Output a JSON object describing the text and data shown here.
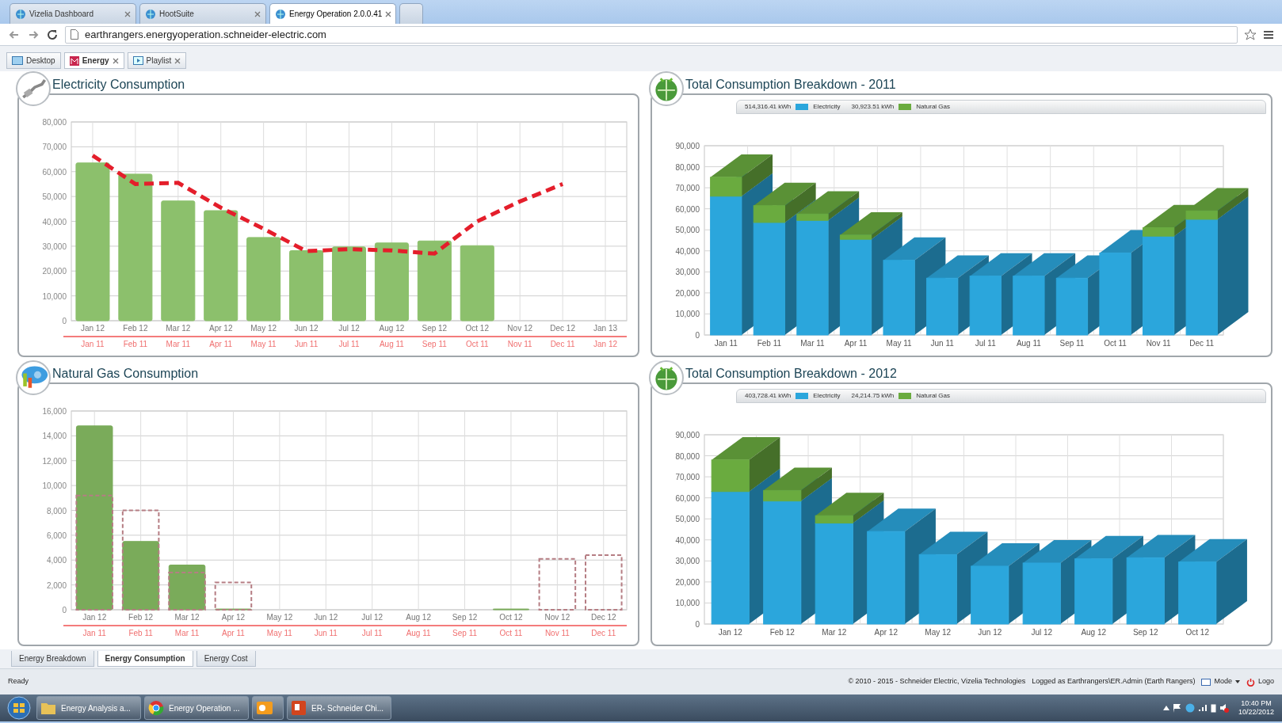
{
  "browser": {
    "tabs": [
      {
        "label": "Vizelia Dashboard",
        "selected": false,
        "closable": true
      },
      {
        "label": "HootSuite",
        "selected": false,
        "closable": true
      },
      {
        "label": "Energy Operation 2.0.0.41",
        "selected": true,
        "closable": true
      }
    ],
    "address": "earthrangers.energyoperation.schneider-electric.com"
  },
  "app_tabs": [
    {
      "label": "Desktop",
      "selected": false,
      "closable": false,
      "kind": "desktop"
    },
    {
      "label": "Energy",
      "selected": true,
      "closable": true,
      "kind": "energy"
    },
    {
      "label": "Playlist",
      "selected": false,
      "closable": true,
      "kind": "playlist"
    }
  ],
  "panels": [
    {
      "title": "Electricity Consumption",
      "kind": "plug",
      "secondary_axis": [
        "Jan 11",
        "Feb 11",
        "Mar 11",
        "Apr 11",
        "May 11",
        "Jun 11",
        "Jul 11",
        "Aug 11",
        "Sep 11",
        "Oct 11",
        "Nov 11",
        "Dec 11",
        "Jan 12"
      ],
      "chart_data": {
        "type": "bar",
        "grid": true,
        "categories": [
          "Jan 12",
          "Feb 12",
          "Mar 12",
          "Apr 12",
          "May 12",
          "Jun 12",
          "Jul 12",
          "Aug 12",
          "Sep 12",
          "Oct 12",
          "Nov 12",
          "Dec 12",
          "Jan 13"
        ],
        "ylim": [
          0,
          80000
        ],
        "yticks": [
          {
            "value": 0,
            "label": "0"
          },
          {
            "value": 10000,
            "label": "10,000"
          },
          {
            "value": 20000,
            "label": "20,000"
          },
          {
            "value": 30000,
            "label": "30,000"
          },
          {
            "value": 40000,
            "label": "40,000"
          },
          {
            "value": 50000,
            "label": "50,000"
          },
          {
            "value": 60000,
            "label": "60,000"
          },
          {
            "value": 70000,
            "label": "70,000"
          },
          {
            "value": 80000,
            "label": "80,000"
          }
        ],
        "series": [
          {
            "type": "bar",
            "color": "#8cc06c",
            "values": [
              63500,
              59000,
              48200,
              44300,
              33500,
              28200,
              29700,
              31300,
              32100,
              30200,
              null,
              null,
              null
            ]
          },
          {
            "type": "line",
            "line_style": "dashed",
            "color": "#e41e2b",
            "values": [
              66500,
              55000,
              55500,
              45500,
              37000,
              28000,
              28800,
              28300,
              27000,
              40000,
              48000,
              55000,
              null
            ]
          }
        ]
      }
    },
    {
      "title": "Total Consumption Breakdown - 2011",
      "kind": "earth",
      "totals": [
        "514,316.41 kWh",
        "30,923.51 kWh"
      ],
      "chart_data": {
        "type": "bar",
        "grid": true,
        "stacked": true,
        "categories": [
          "Jan 11",
          "Feb 11",
          "Mar 11",
          "Apr 11",
          "May 11",
          "Jun 11",
          "Jul 11",
          "Aug 11",
          "Sep 11",
          "Oct 11",
          "Nov 11",
          "Dec 11"
        ],
        "ylim": [
          0,
          90000
        ],
        "yticks": [
          {
            "value": 0,
            "label": "0"
          },
          {
            "value": 10000,
            "label": "10,000"
          },
          {
            "value": 20000,
            "label": "20,000"
          },
          {
            "value": 30000,
            "label": "30,000"
          },
          {
            "value": 40000,
            "label": "40,000"
          },
          {
            "value": 50000,
            "label": "50,000"
          },
          {
            "value": 60000,
            "label": "60,000"
          },
          {
            "value": 70000,
            "label": "70,000"
          },
          {
            "value": 80000,
            "label": "80,000"
          },
          {
            "value": 90000,
            "label": "90,000"
          }
        ],
        "series": [
          {
            "name": "Electricity",
            "color": "#2ba6dc",
            "values": [
              66000,
              53500,
              54500,
              45500,
              35500,
              27000,
              28000,
              28000,
              27000,
              39000,
              47000,
              55000
            ]
          },
          {
            "name": "Natural Gas",
            "color": "#6aab3f",
            "values": [
              9000,
              8000,
              3000,
              2000,
              0,
              0,
              0,
              0,
              0,
              0,
              4000,
              4000
            ]
          }
        ]
      }
    },
    {
      "title": "Natural Gas Consumption",
      "kind": "gas",
      "secondary_axis": [
        "Jan 11",
        "Feb 11",
        "Mar 11",
        "Apr 11",
        "May 11",
        "Jun 11",
        "Jul 11",
        "Aug 11",
        "Sep 11",
        "Oct 11",
        "Nov 11",
        "Dec 11"
      ],
      "chart_data": {
        "type": "bar",
        "grid": true,
        "categories": [
          "Jan 12",
          "Feb 12",
          "Mar 12",
          "Apr 12",
          "May 12",
          "Jun 12",
          "Jul 12",
          "Aug 12",
          "Sep 12",
          "Oct 12",
          "Nov 12",
          "Dec 12"
        ],
        "ylim": [
          0,
          16000
        ],
        "yticks": [
          {
            "value": 0,
            "label": "0"
          },
          {
            "value": 2000,
            "label": "2,000"
          },
          {
            "value": 4000,
            "label": "4,000"
          },
          {
            "value": 6000,
            "label": "6,000"
          },
          {
            "value": 8000,
            "label": "8,000"
          },
          {
            "value": 10000,
            "label": "10,000"
          },
          {
            "value": 12000,
            "label": "12,000"
          },
          {
            "value": 14000,
            "label": "14,000"
          },
          {
            "value": 16000,
            "label": "16,000"
          }
        ],
        "series": [
          {
            "type": "bar",
            "color": "#7aab5a",
            "values": [
              14800,
              5500,
              3600,
              60,
              0,
              0,
              0,
              0,
              0,
              60,
              null,
              null
            ]
          },
          {
            "type": "bar",
            "line_style": "dashed",
            "color": "#b57d83",
            "values": [
              9200,
              8000,
              3000,
              2200,
              0,
              0,
              0,
              0,
              0,
              0,
              4100,
              4400
            ]
          }
        ]
      }
    },
    {
      "title": "Total Consumption Breakdown - 2012",
      "kind": "earth",
      "totals": [
        "403,728.41 kWh",
        "24,214.75 kWh"
      ],
      "chart_data": {
        "type": "bar",
        "grid": true,
        "stacked": true,
        "categories": [
          "Jan 12",
          "Feb 12",
          "Mar 12",
          "Apr 12",
          "May 12",
          "Jun 12",
          "Jul 12",
          "Aug 12",
          "Sep 12",
          "Oct 12"
        ],
        "ylim": [
          0,
          90000
        ],
        "yticks": [
          {
            "value": 0,
            "label": "0"
          },
          {
            "value": 10000,
            "label": "10,000"
          },
          {
            "value": 20000,
            "label": "20,000"
          },
          {
            "value": 30000,
            "label": "30,000"
          },
          {
            "value": 40000,
            "label": "40,000"
          },
          {
            "value": 50000,
            "label": "50,000"
          },
          {
            "value": 60000,
            "label": "60,000"
          },
          {
            "value": 70000,
            "label": "70,000"
          },
          {
            "value": 80000,
            "label": "80,000"
          },
          {
            "value": 90000,
            "label": "90,000"
          }
        ],
        "series": [
          {
            "name": "Electricity",
            "color": "#2ba6dc",
            "values": [
              63000,
              58500,
              48000,
              44000,
              33000,
              27500,
              29000,
              31000,
              31500,
              29500
            ]
          },
          {
            "name": "Natural Gas",
            "color": "#6aab3f",
            "values": [
              15000,
              5000,
              3500,
              0,
              0,
              0,
              0,
              0,
              0,
              0
            ]
          }
        ]
      }
    }
  ],
  "view_tabs": [
    {
      "label": "Energy Breakdown",
      "selected": false
    },
    {
      "label": "Energy Consumption",
      "selected": true
    },
    {
      "label": "Energy Cost",
      "selected": false
    }
  ],
  "status_bar": {
    "state": "Ready",
    "copyright": "© 2010 - 2015 - Schneider Electric, Vizelia Technologies",
    "login": "Logged as Earthrangers\\ER.Admin (Earth Rangers)",
    "mode": "Mode",
    "logout": "Logo"
  },
  "taskbar": {
    "buttons": [
      {
        "kind": "folder",
        "label": "Energy Analysis a..."
      },
      {
        "kind": "browser",
        "label": "Energy Operation ..."
      },
      {
        "kind": "mail"
      },
      {
        "kind": "slides",
        "label": "ER- Schneider Chi..."
      }
    ],
    "time": "10:40 PM",
    "date": "10/22/2012"
  }
}
